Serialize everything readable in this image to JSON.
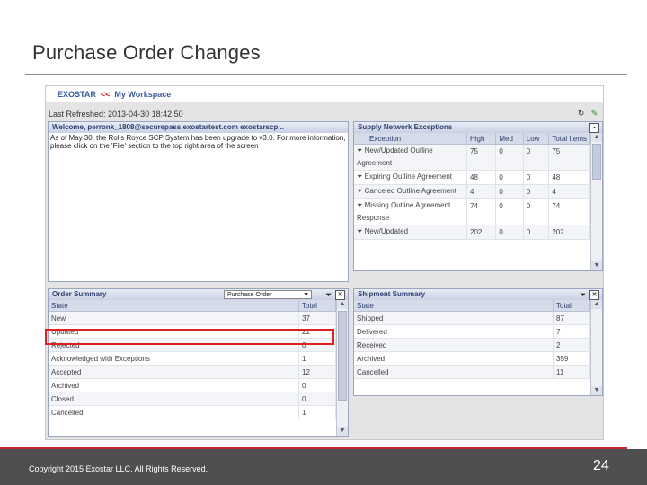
{
  "slide": {
    "title": "Purchase Order Changes",
    "copyright": "Copyright 2015 Exostar LLC. All Rights Reserved.",
    "page_number": "24"
  },
  "workspace": {
    "brand": "EXOSTAR",
    "separator": "<<",
    "link": "My Workspace",
    "last_refreshed": "Last Refreshed: 2013-04-30 18:42:50",
    "icons": [
      "refresh-icon",
      "edit-icon"
    ]
  },
  "welcome": {
    "greeting": "Welcome, perronk_1808@securepass.exostartest.com exostarscp...",
    "message": "As of May 30, the Rolls Royce SCP System has been upgrade to v3.0. For more information, please click on the 'File' section to the top right area of the screen"
  },
  "exceptions": {
    "title": "Supply Network Exceptions",
    "columns": [
      "Exception",
      "High",
      "Med",
      "Low",
      "Total Items"
    ],
    "rows": [
      [
        "New/Updated Outline Agreement",
        "75",
        "0",
        "0",
        "75"
      ],
      [
        "Expiring Outline Agreement",
        "48",
        "0",
        "0",
        "48"
      ],
      [
        "Canceled Outline Agreement",
        "4",
        "0",
        "0",
        "4"
      ],
      [
        "Missing Outline Agreement Response",
        "74",
        "0",
        "0",
        "74"
      ],
      [
        "New/Updated",
        "202",
        "0",
        "0",
        "202"
      ]
    ]
  },
  "order_summary": {
    "title": "Order Summary",
    "dropdown_value": "Purchase Order",
    "columns": [
      "State",
      "Total"
    ],
    "rows": [
      [
        "New",
        "37"
      ],
      [
        "Updated",
        "21"
      ],
      [
        "Rejected",
        "0"
      ],
      [
        "Acknowledged with Exceptions",
        "1"
      ],
      [
        "Accepted",
        "12"
      ],
      [
        "Archived",
        "0"
      ],
      [
        "Closed",
        "0"
      ],
      [
        "Cancelled",
        "1"
      ]
    ]
  },
  "shipment_summary": {
    "title": "Shipment Summary",
    "columns": [
      "State",
      "Total"
    ],
    "rows": [
      [
        "Shipped",
        "87"
      ],
      [
        "Delivered",
        "7"
      ],
      [
        "Received",
        "2"
      ],
      [
        "Archived",
        "359"
      ],
      [
        "Cancelled",
        "11"
      ]
    ]
  },
  "colors": {
    "highlight": "#e02020",
    "footer": "#4f4f4f",
    "accent_red": "#c9252b",
    "header_blue": "#2c3f6e"
  }
}
